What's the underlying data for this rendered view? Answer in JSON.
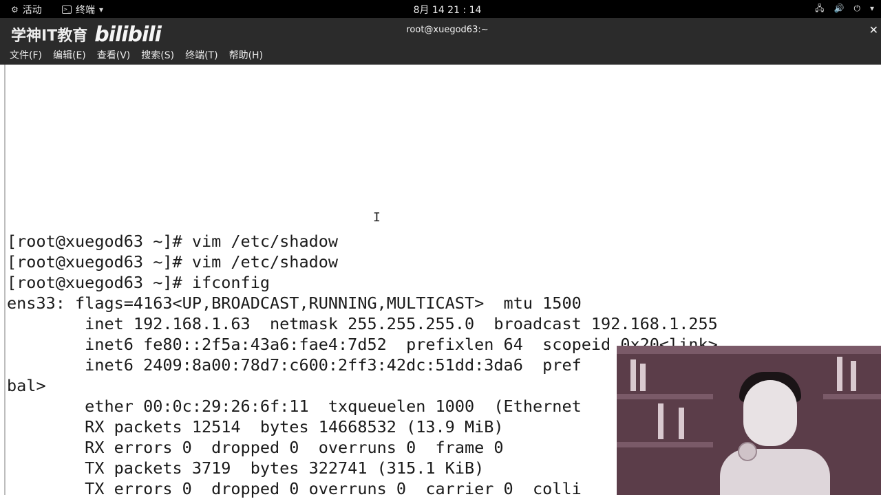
{
  "topbar": {
    "activities": "活动",
    "app_name": "终端",
    "clock": "8月 14  21 : 14"
  },
  "titlebar": {
    "watermark": "学神IT教育",
    "watermark_logo": "bilibili",
    "window_title": "root@xuegod63:~"
  },
  "menu": {
    "file": "文件(F)",
    "edit": "编辑(E)",
    "view": "查看(V)",
    "search": "搜索(S)",
    "terminal": "终端(T)",
    "help": "帮助(H)"
  },
  "terminal": {
    "lines": [
      "[root@xuegod63 ~]# vim /etc/shadow",
      "[root@xuegod63 ~]# vim /etc/shadow",
      "[root@xuegod63 ~]# ifconfig",
      "ens33: flags=4163<UP,BROADCAST,RUNNING,MULTICAST>  mtu 1500",
      "        inet 192.168.1.63  netmask 255.255.255.0  broadcast 192.168.1.255",
      "        inet6 fe80::2f5a:43a6:fae4:7d52  prefixlen 64  scopeid 0x20<link>",
      "        inet6 2409:8a00:78d7:c600:2ff3:42dc:51dd:3da6  pref",
      "bal>",
      "        ether 00:0c:29:26:6f:11  txqueuelen 1000  (Ethernet",
      "        RX packets 12514  bytes 14668532 (13.9 MiB)",
      "        RX errors 0  dropped 0  overruns 0  frame 0",
      "        TX packets 3719  bytes 322741 (315.1 KiB)",
      "        TX errors 0  dropped 0 overruns 0  carrier 0  colli"
    ]
  },
  "icons": {
    "activities": "gear-icon",
    "app": "terminal-icon",
    "network": "network-icon",
    "volume": "volume-icon",
    "power": "power-icon",
    "cursor": "ibeam-cursor-icon"
  }
}
